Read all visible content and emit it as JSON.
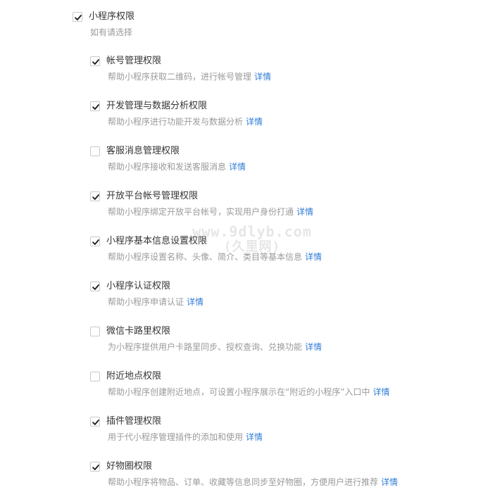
{
  "root": {
    "label": "小程序权限",
    "hint": "如有请选择",
    "checked": true
  },
  "items": [
    {
      "label": "帐号管理权限",
      "desc": "帮助小程序获取二维码，进行帐号管理",
      "detail": "详情",
      "checked": true
    },
    {
      "label": "开发管理与数据分析权限",
      "desc": "帮助小程序进行功能开发与数据分析",
      "detail": "详情",
      "checked": true
    },
    {
      "label": "客服消息管理权限",
      "desc": "帮助小程序接收和发送客服消息",
      "detail": "详情",
      "checked": false
    },
    {
      "label": "开放平台帐号管理权限",
      "desc": "帮助小程序绑定开放平台帐号，实现用户身份打通",
      "detail": "详情",
      "checked": true
    },
    {
      "label": "小程序基本信息设置权限",
      "desc": "帮助小程序设置名称、头像、简介、类目等基本信息",
      "detail": "详情",
      "checked": true
    },
    {
      "label": "小程序认证权限",
      "desc": "帮助小程序申请认证",
      "detail": "详情",
      "checked": true
    },
    {
      "label": "微信卡路里权限",
      "desc": "为小程序提供用户卡路里同步、授权查询、兑换功能",
      "detail": "详情",
      "checked": false
    },
    {
      "label": "附近地点权限",
      "desc": "帮助小程序创建附近地点，可设置小程序展示在“附近的小程序”入口中",
      "detail": "详情",
      "checked": false
    },
    {
      "label": "插件管理权限",
      "desc": "用于代小程序管理插件的添加和使用",
      "detail": "详情",
      "checked": true
    },
    {
      "label": "好物圈权限",
      "desc": "帮助小程序将物品、订单、收藏等信息同步至好物圈，方便用户进行推荐",
      "detail": "详情",
      "checked": true
    }
  ],
  "watermark": {
    "line1": "www.9dlyb.com",
    "line2": "(久里网)"
  },
  "colors": {
    "check": "#1a1a1a",
    "link": "#2f7bd6",
    "desc": "#9a9a9a"
  }
}
